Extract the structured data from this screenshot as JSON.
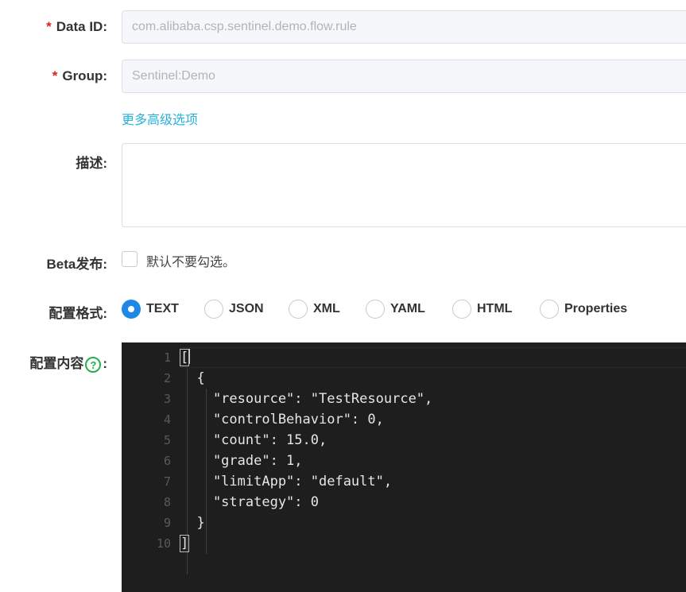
{
  "form": {
    "data_id": {
      "label": "Data ID:",
      "required_mark": "*",
      "value": "com.alibaba.csp.sentinel.demo.flow.rule"
    },
    "group": {
      "label": "Group:",
      "required_mark": "*",
      "value": "Sentinel:Demo"
    },
    "advanced_link": "更多高级选项",
    "description": {
      "label": "描述:",
      "value": ""
    },
    "beta": {
      "label": "Beta发布:",
      "checkbox_text": "默认不要勾选。",
      "checked": false
    },
    "format": {
      "label": "配置格式:",
      "selected": "TEXT",
      "options": [
        "TEXT",
        "JSON",
        "XML",
        "YAML",
        "HTML",
        "Properties"
      ]
    },
    "content": {
      "label_text": "配置内容",
      "help_icon": "?",
      "colon": ":"
    }
  },
  "editor": {
    "line_numbers": [
      "1",
      "2",
      "3",
      "4",
      "5",
      "6",
      "7",
      "8",
      "9",
      "10"
    ],
    "lines": [
      "[",
      "  {",
      "    \"resource\": \"TestResource\",",
      "    \"controlBehavior\": 0,",
      "    \"count\": 15.0,",
      "    \"grade\": 1,",
      "    \"limitApp\": \"default\",",
      "    \"strategy\": 0",
      "  }",
      "]"
    ]
  },
  "colors": {
    "accent": "#1e88e5",
    "link": "#2ab0d8",
    "required": "#e02020",
    "help_icon": "#22b14c",
    "editor_bg": "#1e1e1e"
  }
}
